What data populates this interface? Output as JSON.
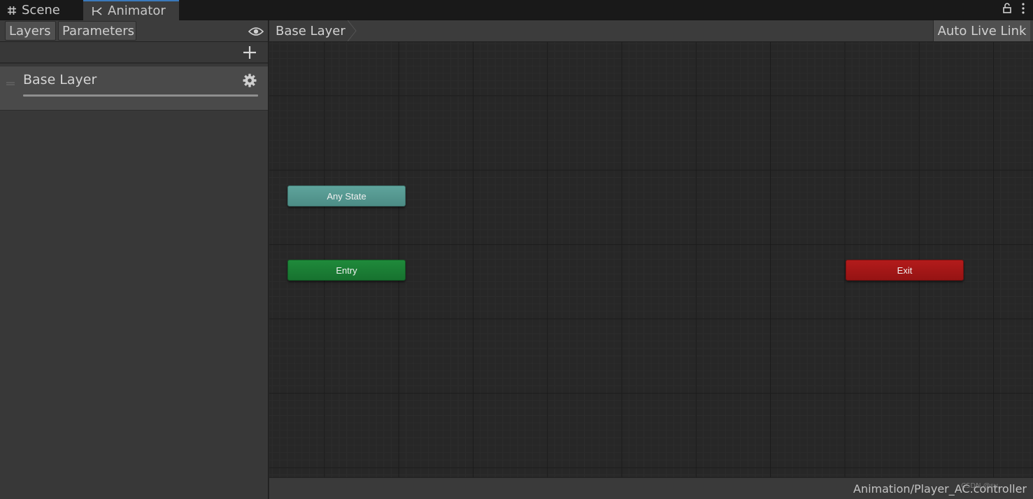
{
  "tabs": [
    {
      "label": "Scene",
      "icon": "hash-icon"
    },
    {
      "label": "Animator",
      "icon": "animator-icon",
      "active": true
    }
  ],
  "window_actions": {
    "lock_icon": "lock-icon",
    "menu_icon": "kebab-menu-icon"
  },
  "left_panel": {
    "tabs": [
      "Layers",
      "Parameters"
    ],
    "active_tab": "Layers",
    "visibility_icon": "eye-icon",
    "add_icon": "plus-icon",
    "layers": [
      {
        "name": "Base Layer",
        "weight": 1.0
      }
    ]
  },
  "graph": {
    "breadcrumb": [
      "Base Layer"
    ],
    "auto_live_link_label": "Auto Live Link",
    "nodes": [
      {
        "name": "Any State",
        "kind": "any-state",
        "color": "#5fa49c"
      },
      {
        "name": "Entry",
        "kind": "entry",
        "color": "#1f8a3b"
      },
      {
        "name": "Exit",
        "kind": "exit",
        "color": "#b31b1b"
      }
    ]
  },
  "status_bar": {
    "asset_path": "Animation/Player_AC.controller",
    "watermark": "CSDN @sy..."
  },
  "colors": {
    "accent_tab": "#3a79bb",
    "canvas_bg": "#272727",
    "panel_bg": "#383838"
  }
}
